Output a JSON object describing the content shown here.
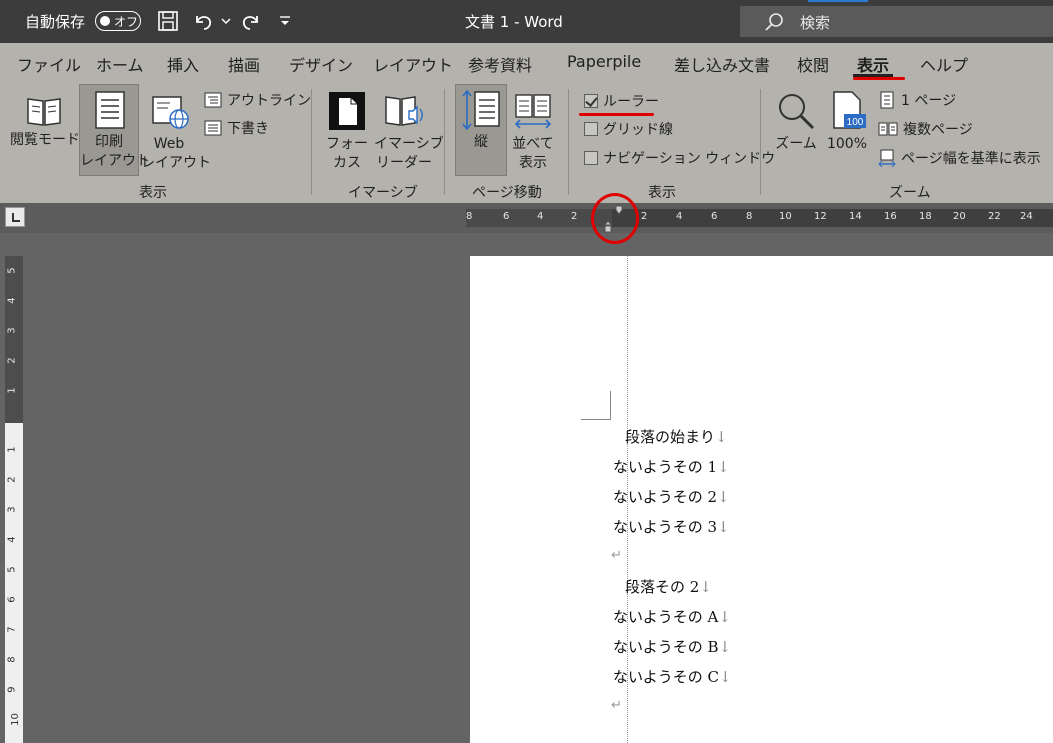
{
  "titlebar": {
    "autosave_label": "自動保存",
    "autosave_state": "オフ",
    "doc_title": "文書 1  -  Word",
    "search_placeholder": "検索"
  },
  "tabs": [
    {
      "label": "ファイル"
    },
    {
      "label": "ホーム"
    },
    {
      "label": "挿入"
    },
    {
      "label": "描画"
    },
    {
      "label": "デザイン"
    },
    {
      "label": "レイアウト"
    },
    {
      "label": "参考資料"
    },
    {
      "label": "Paperpile"
    },
    {
      "label": "差し込み文書"
    },
    {
      "label": "校閲"
    },
    {
      "label": "表示"
    },
    {
      "label": "ヘルプ"
    }
  ],
  "active_tab": "表示",
  "ribbon": {
    "views": {
      "read_mode": "閲覧モード",
      "print_layout_1": "印刷",
      "print_layout_2": "レイアウト",
      "web_layout_1": "Web",
      "web_layout_2": "レイアウト",
      "outline": "アウトライン",
      "draft": "下書き",
      "group_label": "表示"
    },
    "immersive": {
      "focus_1": "フォー",
      "focus_2": "カス",
      "reader_1": "イマーシブ",
      "reader_2": "リーダー",
      "group_label": "イマーシブ"
    },
    "page_move": {
      "vertical": "縦",
      "side_1": "並べて",
      "side_2": "表示",
      "group_label": "ページ移動"
    },
    "show": {
      "ruler": "ルーラー",
      "ruler_checked": true,
      "gridlines": "グリッド線",
      "nav_pane": "ナビゲーション ウィンドウ",
      "group_label": "表示"
    },
    "zoom": {
      "zoom": "ズーム",
      "percent": "100%",
      "percent_badge": "100",
      "one_page": "1 ページ",
      "multi_page": "複数ページ",
      "page_width": "ページ幅を基準に表示",
      "group_label": "ズーム"
    }
  },
  "hruler_ticks": [
    "8",
    "6",
    "4",
    "2",
    "2",
    "4",
    "6",
    "8",
    "10",
    "12",
    "14",
    "16",
    "18",
    "20",
    "22",
    "24"
  ],
  "vruler_ticks_top": [
    "5",
    "4",
    "3",
    "2",
    "1"
  ],
  "vruler_ticks_bottom": [
    "1",
    "2",
    "3",
    "4",
    "5",
    "6",
    "7",
    "8",
    "9",
    "10"
  ],
  "document": {
    "lines": [
      "段落の始まり",
      "ないようその 1",
      "ないようその 2",
      "ないようその 3",
      "",
      "段落その 2",
      "ないようその A",
      "ないようその B",
      "ないようその C",
      ""
    ],
    "line_break_mark": "↓",
    "paragraph_mark": "↵"
  }
}
